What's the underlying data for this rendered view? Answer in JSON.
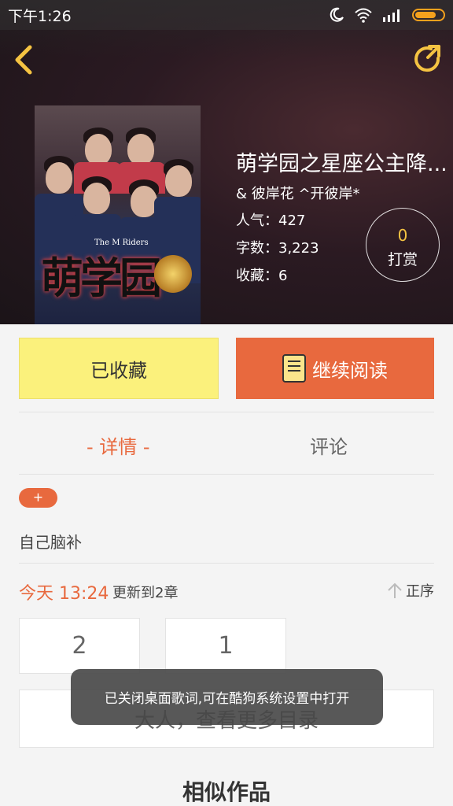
{
  "status_bar": {
    "time": "下午1:26"
  },
  "book": {
    "title": "萌学园之星座公主降...",
    "author": "& 彼岸花 ^开彼岸*",
    "popularity": "人气：427",
    "word_count": "字数：3,223",
    "favorites": "收藏：6",
    "reward_count": "0",
    "reward_label": "打赏",
    "cover_title": "萌学园",
    "cover_subtitle": "The M Riders"
  },
  "actions": {
    "favorited_label": "已收藏",
    "continue_label": "继续阅读"
  },
  "tabs": {
    "detail": "- 详情 -",
    "comment": "评论"
  },
  "detail": {
    "tag": "+",
    "intro": "自己脑补",
    "update_time": "今天 13:24",
    "update_text": "更新到2章",
    "sort_label": "正序",
    "chapters": [
      "2",
      "1"
    ],
    "more_catalog": "大人，查看更多目录",
    "similar_title": "相似作品"
  },
  "toast": "已关闭桌面歌词,可在酷狗系统设置中打开",
  "colors": {
    "accent": "#e8693e",
    "favorite_bg": "#fbf17c",
    "reward_number": "#f5c342"
  }
}
